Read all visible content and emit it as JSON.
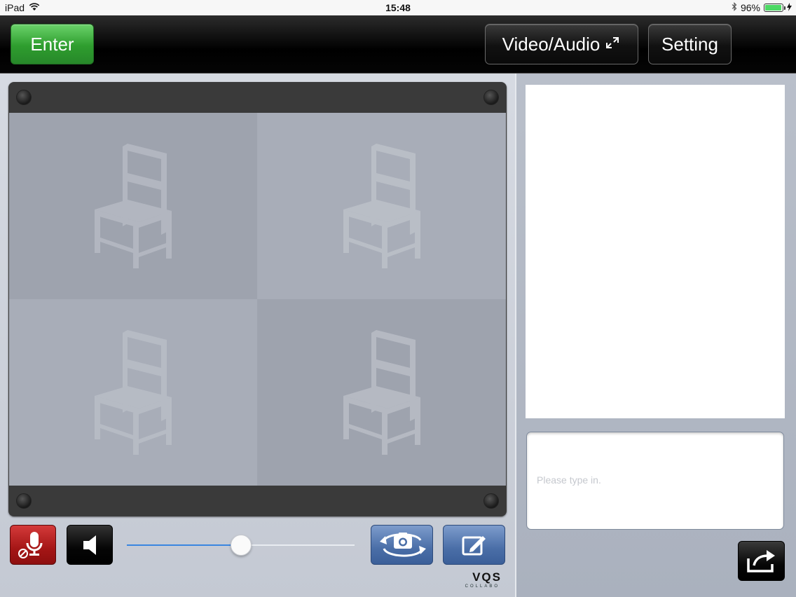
{
  "status_bar": {
    "device": "iPad",
    "time": "15:48",
    "battery_percent": "96%",
    "battery_level": 0.96,
    "icons": [
      "wifi-icon",
      "bluetooth-icon",
      "battery-icon",
      "charging-icon"
    ]
  },
  "toolbar": {
    "enter_label": "Enter",
    "video_audio_label": "Video/Audio",
    "setting_label": "Setting"
  },
  "video_panel": {
    "tiles": [
      "chair-placeholder",
      "chair-placeholder",
      "chair-placeholder",
      "chair-placeholder"
    ]
  },
  "controls": {
    "mic_icon": "microphone-muted-icon",
    "speaker_icon": "speaker-icon",
    "volume_level": 0.5,
    "camera_icon": "camera-switch-icon",
    "edit_icon": "edit-icon"
  },
  "logo": {
    "main": "VQS",
    "sub": "COLLABO"
  },
  "chat": {
    "input_placeholder": "Please type in.",
    "input_value": "",
    "send_icon": "send-icon"
  },
  "colors": {
    "enter_green": "#3aa83a",
    "mic_red": "#b71c1c",
    "action_blue": "#5577ad"
  }
}
